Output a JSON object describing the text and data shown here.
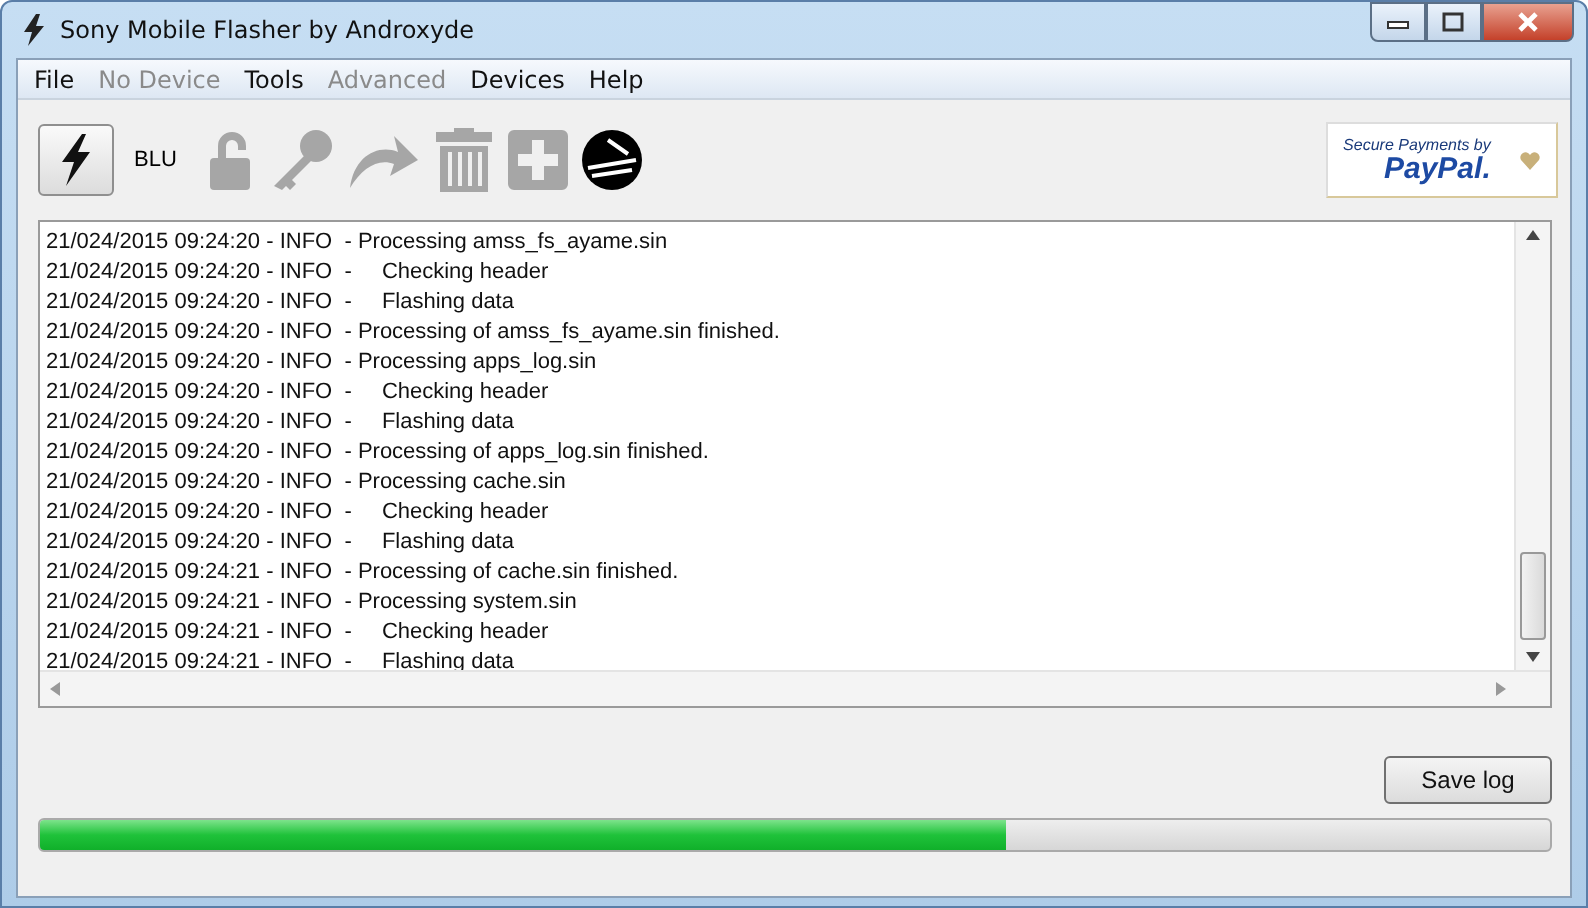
{
  "window": {
    "title": "Sony Mobile Flasher by Androxyde"
  },
  "menu": [
    {
      "label": "File",
      "disabled": false
    },
    {
      "label": "No Device",
      "disabled": true
    },
    {
      "label": "Tools",
      "disabled": false
    },
    {
      "label": "Advanced",
      "disabled": true
    },
    {
      "label": "Devices",
      "disabled": false
    },
    {
      "label": "Help",
      "disabled": false
    }
  ],
  "toolbar": [
    {
      "kind": "flash",
      "disabled": false
    },
    {
      "kind": "label",
      "text": "BLU"
    },
    {
      "kind": "lock",
      "disabled": true
    },
    {
      "kind": "key",
      "disabled": true
    },
    {
      "kind": "arrow",
      "disabled": true
    },
    {
      "kind": "trash",
      "disabled": true
    },
    {
      "kind": "plus",
      "disabled": true
    },
    {
      "kind": "logo",
      "disabled": false
    }
  ],
  "donate": {
    "caption": "Secure Payments by",
    "brand": "PayPal."
  },
  "log": [
    {
      "prefix": "21/024/2015 09:24:20 - INFO  -",
      "message": "Processing amss_fs_ayame.sin",
      "nested": false
    },
    {
      "prefix": "21/024/2015 09:24:20 - INFO  -",
      "message": "Checking header",
      "nested": true
    },
    {
      "prefix": "21/024/2015 09:24:20 - INFO  -",
      "message": "Flashing data",
      "nested": true
    },
    {
      "prefix": "21/024/2015 09:24:20 - INFO  -",
      "message": "Processing of amss_fs_ayame.sin finished.",
      "nested": false
    },
    {
      "prefix": "21/024/2015 09:24:20 - INFO  -",
      "message": "Processing apps_log.sin",
      "nested": false
    },
    {
      "prefix": "21/024/2015 09:24:20 - INFO  -",
      "message": "Checking header",
      "nested": true
    },
    {
      "prefix": "21/024/2015 09:24:20 - INFO  -",
      "message": "Flashing data",
      "nested": true
    },
    {
      "prefix": "21/024/2015 09:24:20 - INFO  -",
      "message": "Processing of apps_log.sin finished.",
      "nested": false
    },
    {
      "prefix": "21/024/2015 09:24:20 - INFO  -",
      "message": "Processing cache.sin",
      "nested": false
    },
    {
      "prefix": "21/024/2015 09:24:20 - INFO  -",
      "message": "Checking header",
      "nested": true
    },
    {
      "prefix": "21/024/2015 09:24:20 - INFO  -",
      "message": "Flashing data",
      "nested": true
    },
    {
      "prefix": "21/024/2015 09:24:21 - INFO  -",
      "message": "Processing of cache.sin finished.",
      "nested": false
    },
    {
      "prefix": "21/024/2015 09:24:21 - INFO  -",
      "message": "Processing system.sin",
      "nested": false
    },
    {
      "prefix": "21/024/2015 09:24:21 - INFO  -",
      "message": "Checking header",
      "nested": true
    },
    {
      "prefix": "21/024/2015 09:24:21 - INFO  -",
      "message": "Flashing data",
      "nested": true
    }
  ],
  "save_button": "Save log",
  "progress": {
    "level": 0.64
  }
}
